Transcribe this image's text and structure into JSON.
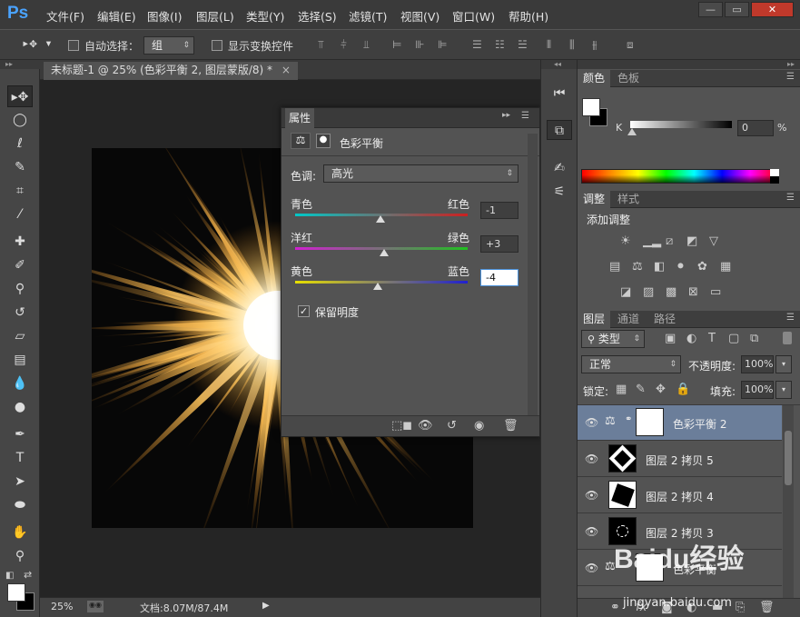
{
  "app": {
    "logo": "Ps"
  },
  "menu": [
    "文件(F)",
    "编辑(E)",
    "图像(I)",
    "图层(L)",
    "类型(Y)",
    "选择(S)",
    "滤镜(T)",
    "视图(V)",
    "窗口(W)",
    "帮助(H)"
  ],
  "window_controls": {
    "minimize": "—",
    "restore": "▭",
    "close": "✕"
  },
  "options": {
    "auto_select_label": "自动选择：",
    "auto_select_value": "组",
    "show_transform_label": "显示变换控件"
  },
  "document": {
    "tab_title": "未标题-1 @ 25% (色彩平衡 2, 图层蒙版/8) *",
    "tab_close": "×"
  },
  "status": {
    "zoom": "25%",
    "doc_info": "文档:8.07M/87.4M"
  },
  "properties": {
    "panel_title": "属性",
    "adjustment_name": "色彩平衡",
    "tone_label": "色调:",
    "tone_value": "高光",
    "sliders": [
      {
        "left": "青色",
        "right": "红色",
        "value": "-1",
        "level": -1
      },
      {
        "left": "洋红",
        "right": "绿色",
        "value": "+3",
        "level": 3
      },
      {
        "left": "黄色",
        "right": "蓝色",
        "value": "-4",
        "level": -4
      }
    ],
    "preserve_luminosity_label": "保留明度",
    "preserve_luminosity_checked": true
  },
  "color_panel": {
    "tabs": [
      "颜色",
      "色板"
    ],
    "channel_label": "K",
    "channel_value": "0",
    "unit": "%"
  },
  "adjustments_panel": {
    "tabs": [
      "调整",
      "样式"
    ],
    "heading": "添加调整"
  },
  "layers_panel": {
    "tabs": [
      "图层",
      "通道",
      "路径"
    ],
    "filter_kind": "类型",
    "blend_mode": "正常",
    "opacity_label": "不透明度:",
    "opacity_value": "100%",
    "lock_label": "锁定:",
    "fill_label": "填充:",
    "fill_value": "100%",
    "layers": [
      {
        "name": "色彩平衡 2",
        "selected": true,
        "kind": "adjustment"
      },
      {
        "name": "图层 2 拷贝 5",
        "selected": false,
        "kind": "pixel"
      },
      {
        "name": "图层 2 拷贝 4",
        "selected": false,
        "kind": "pixel"
      },
      {
        "name": "图层 2 拷贝 3",
        "selected": false,
        "kind": "pixel"
      },
      {
        "name": "色彩平衡",
        "selected": false,
        "kind": "adjustment"
      }
    ]
  },
  "watermark": {
    "text": "Baidu经验",
    "url": "jingyan.baidu.com"
  }
}
